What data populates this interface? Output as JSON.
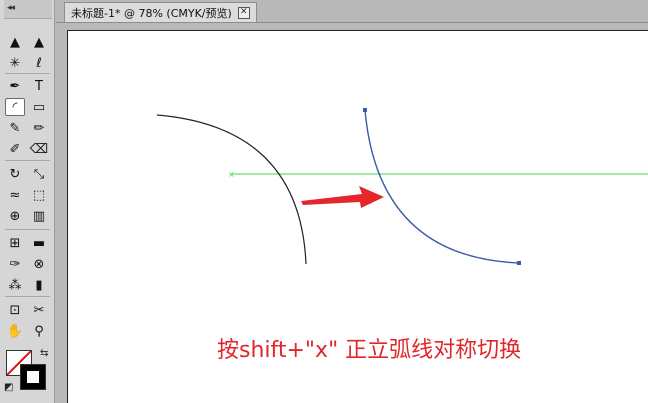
{
  "document_tab": {
    "title": "未标题-1* @ 78% (CMYK/预览)",
    "close_glyph": "✕"
  },
  "toolbox": {
    "tools": [
      {
        "name": "selection-tool-icon",
        "glyph": "▲"
      },
      {
        "name": "direct-selection-tool-icon",
        "glyph": "▲"
      },
      {
        "name": "magic-wand-tool-icon",
        "glyph": "✳"
      },
      {
        "name": "lasso-tool-icon",
        "glyph": "ℓ"
      },
      {
        "name": "pen-tool-icon",
        "glyph": "✒"
      },
      {
        "name": "type-tool-icon",
        "glyph": "T"
      },
      {
        "name": "arc-tool-icon",
        "glyph": "◜"
      },
      {
        "name": "rectangle-tool-icon",
        "glyph": "▭"
      },
      {
        "name": "paintbrush-tool-icon",
        "glyph": "✎"
      },
      {
        "name": "pencil-tool-icon",
        "glyph": "✏"
      },
      {
        "name": "blob-brush-tool-icon",
        "glyph": "✐"
      },
      {
        "name": "eraser-tool-icon",
        "glyph": "⌫"
      },
      {
        "name": "rotate-tool-icon",
        "glyph": "↻"
      },
      {
        "name": "scale-tool-icon",
        "glyph": "⤡"
      },
      {
        "name": "warp-tool-icon",
        "glyph": "≈"
      },
      {
        "name": "free-transform-tool-icon",
        "glyph": "⬚"
      },
      {
        "name": "shape-builder-tool-icon",
        "glyph": "⊕"
      },
      {
        "name": "perspective-grid-tool-icon",
        "glyph": "▥"
      },
      {
        "name": "mesh-tool-icon",
        "glyph": "⊞"
      },
      {
        "name": "gradient-tool-icon",
        "glyph": "▬"
      },
      {
        "name": "eyedropper-tool-icon",
        "glyph": "✑"
      },
      {
        "name": "blend-tool-icon",
        "glyph": "⊗"
      },
      {
        "name": "symbol-sprayer-tool-icon",
        "glyph": "⁂"
      },
      {
        "name": "column-graph-tool-icon",
        "glyph": "▮"
      },
      {
        "name": "artboard-tool-icon",
        "glyph": "⊡"
      },
      {
        "name": "slice-tool-icon",
        "glyph": "✂"
      },
      {
        "name": "hand-tool-icon",
        "glyph": "✋"
      },
      {
        "name": "zoom-tool-icon",
        "glyph": "⚲"
      }
    ],
    "swap_glyph": "⇆",
    "default_colors_glyph": "◩"
  },
  "canvas": {
    "caption": "按shift+\"x\" 正立弧线对称切换",
    "colors": {
      "original_arc": "#222222",
      "flipped_arc": "#3a5ba8",
      "guide": "#4cd34c",
      "arrow": "#e5262b",
      "caption": "#e0262a"
    }
  }
}
